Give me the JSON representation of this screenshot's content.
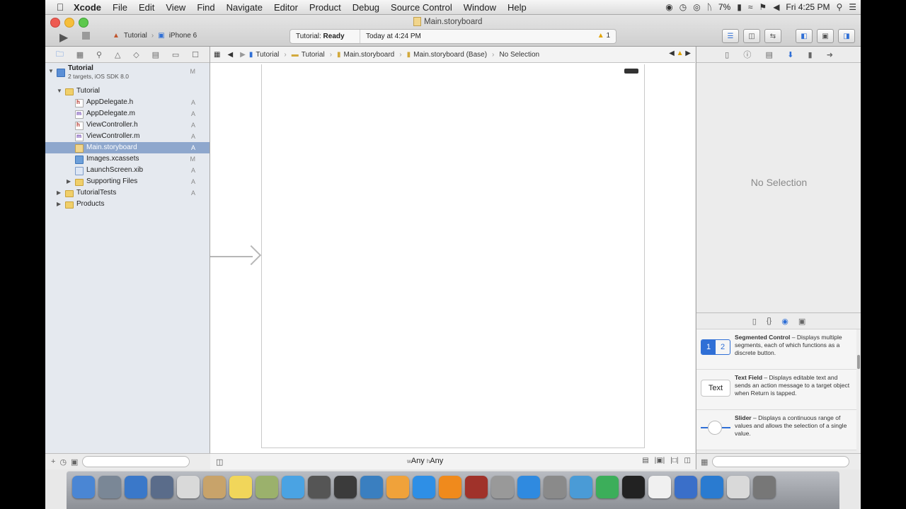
{
  "menubar": {
    "app_name": "Xcode",
    "items": [
      "File",
      "Edit",
      "View",
      "Find",
      "Navigate",
      "Editor",
      "Product",
      "Debug",
      "Source Control",
      "Window",
      "Help"
    ],
    "battery": "7%",
    "clock": "Fri 4:25 PM"
  },
  "window": {
    "title": "Main.storyboard"
  },
  "toolbar": {
    "scheme": "Tutorial",
    "device": "iPhone 6",
    "activity_project": "Tutorial:",
    "activity_status": "Ready",
    "activity_time": "Today at 4:24 PM",
    "warning_count": "1"
  },
  "navigator": {
    "project_name": "Tutorial",
    "project_subtitle": "2 targets, iOS SDK 8.0",
    "project_status": "M",
    "rows": [
      {
        "label": "Tutorial",
        "status": ""
      },
      {
        "label": "AppDelegate.h",
        "status": "A",
        "letter": "h"
      },
      {
        "label": "AppDelegate.m",
        "status": "A",
        "letter": "m"
      },
      {
        "label": "ViewController.h",
        "status": "A",
        "letter": "h"
      },
      {
        "label": "ViewController.m",
        "status": "A",
        "letter": "m"
      },
      {
        "label": "Main.storyboard",
        "status": "A"
      },
      {
        "label": "Images.xcassets",
        "status": "M"
      },
      {
        "label": "LaunchScreen.xib",
        "status": "A"
      },
      {
        "label": "Supporting Files",
        "status": "A"
      },
      {
        "label": "TutorialTests",
        "status": "A"
      },
      {
        "label": "Products",
        "status": ""
      }
    ]
  },
  "jumpbar": {
    "crumbs": [
      "Tutorial",
      "Tutorial",
      "Main.storyboard",
      "Main.storyboard (Base)",
      "No Selection"
    ]
  },
  "editor": {
    "size_width": "Any",
    "size_height": "Any"
  },
  "inspector": {
    "no_selection": "No Selection"
  },
  "library": {
    "items": [
      {
        "title": "Segmented Control",
        "desc": " – Displays multiple segments, each of which functions as a discrete button.",
        "seg1": "1",
        "seg2": "2"
      },
      {
        "title": "Text Field",
        "desc": " – Displays editable text and sends an action message to a target object when Return is tapped.",
        "thumb": "Text"
      },
      {
        "title": "Slider",
        "desc": " – Displays a continuous range of values and allows the selection of a single value."
      }
    ]
  },
  "dock": {
    "icons": [
      "finder",
      "launchpad",
      "safari",
      "preview",
      "calendar",
      "contacts",
      "stickies",
      "textedit",
      "messages",
      "facetime",
      "photobooth",
      "preview-photo",
      "pages",
      "itunes",
      "ibooks",
      "dictionary",
      "calculator",
      "app-store",
      "system-preferences",
      "keynote",
      "numbers",
      "screenrecorder",
      "photos",
      "xcode",
      "quicktime",
      "downloads",
      "trash"
    ]
  }
}
